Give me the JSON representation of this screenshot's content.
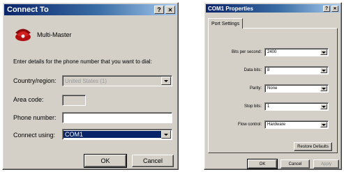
{
  "connect_to": {
    "title": "Connect To",
    "help_btn": "?",
    "close_btn": "✕",
    "connection_name": "Multi-Master",
    "instruction": "Enter details for the phone number that you want to dial:",
    "country_label": "Country/region:",
    "country_value": "United States (1)",
    "area_code_label": "Area code:",
    "area_code_value": "",
    "phone_label": "Phone number:",
    "phone_value": "",
    "connect_using_label": "Connect using:",
    "connect_using_value": "COM1",
    "ok_label": "OK",
    "cancel_label": "Cancel"
  },
  "com1_properties": {
    "title": "COM1 Properties",
    "help_btn": "?",
    "close_btn": "✕",
    "tab_label": "Port Settings",
    "bits_label": "Bits per second:",
    "bits_value": "2400",
    "data_bits_label": "Data bits:",
    "data_bits_value": "8",
    "parity_label": "Parity:",
    "parity_value": "None",
    "stop_bits_label": "Stop bits:",
    "stop_bits_value": "1",
    "flow_label": "Flow control:",
    "flow_value": "Hardware",
    "restore_label": "Restore Defaults",
    "ok_label": "OK",
    "cancel_label": "Cancel",
    "apply_label": "Apply"
  }
}
